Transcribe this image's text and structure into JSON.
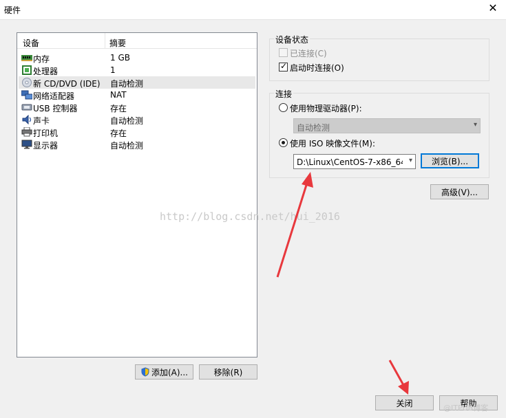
{
  "window": {
    "title": "硬件"
  },
  "device_list": {
    "headers": {
      "device": "设备",
      "summary": "摘要"
    },
    "rows": [
      {
        "name": "内存",
        "summary": "1 GB",
        "icon": "memory-icon"
      },
      {
        "name": "处理器",
        "summary": "1",
        "icon": "processor-icon"
      },
      {
        "name": "新 CD/DVD (IDE)",
        "summary": "自动检测",
        "icon": "cd-dvd-icon",
        "selected": true
      },
      {
        "name": "网络适配器",
        "summary": "NAT",
        "icon": "network-adapter-icon"
      },
      {
        "name": "USB 控制器",
        "summary": "存在",
        "icon": "usb-icon"
      },
      {
        "name": "声卡",
        "summary": "自动检测",
        "icon": "sound-card-icon"
      },
      {
        "name": "打印机",
        "summary": "存在",
        "icon": "printer-icon"
      },
      {
        "name": "显示器",
        "summary": "自动检测",
        "icon": "monitor-icon"
      }
    ]
  },
  "list_buttons": {
    "add": "添加(A)...",
    "remove": "移除(R)"
  },
  "device_status": {
    "title": "设备状态",
    "connected": {
      "label": "已连接(C)",
      "checked": false,
      "disabled": true
    },
    "connect_on_power": {
      "label": "启动时连接(O)",
      "checked": true
    }
  },
  "connection": {
    "title": "连接",
    "physical": {
      "label": "使用物理驱动器(P):",
      "selected": false
    },
    "physical_drive": {
      "value": "自动检测"
    },
    "iso": {
      "label": "使用 ISO 映像文件(M):",
      "selected": true
    },
    "iso_path": {
      "value": "D:\\Linux\\CentOS-7-x86_64-"
    },
    "browse": "浏览(B)..."
  },
  "advanced": "高级(V)...",
  "footer": {
    "close": "关闭",
    "help": "帮助"
  },
  "watermark": {
    "text": "http://blog.csdn.net/hui_2016",
    "corner": "@ITPUB博客"
  },
  "colors": {
    "accent": "#0078d7",
    "annotation": "#e8383d"
  }
}
